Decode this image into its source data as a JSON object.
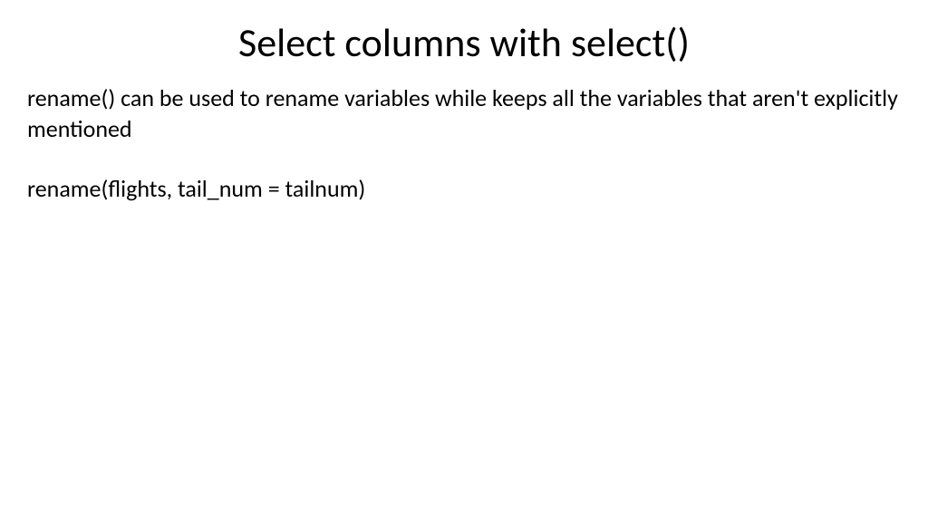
{
  "slide": {
    "title": "Select columns with select()",
    "paragraph1": "rename() can be used to rename variables while keeps all the variables that aren't explicitly mentioned",
    "paragraph2": "rename(flights, tail_num = tailnum)"
  }
}
